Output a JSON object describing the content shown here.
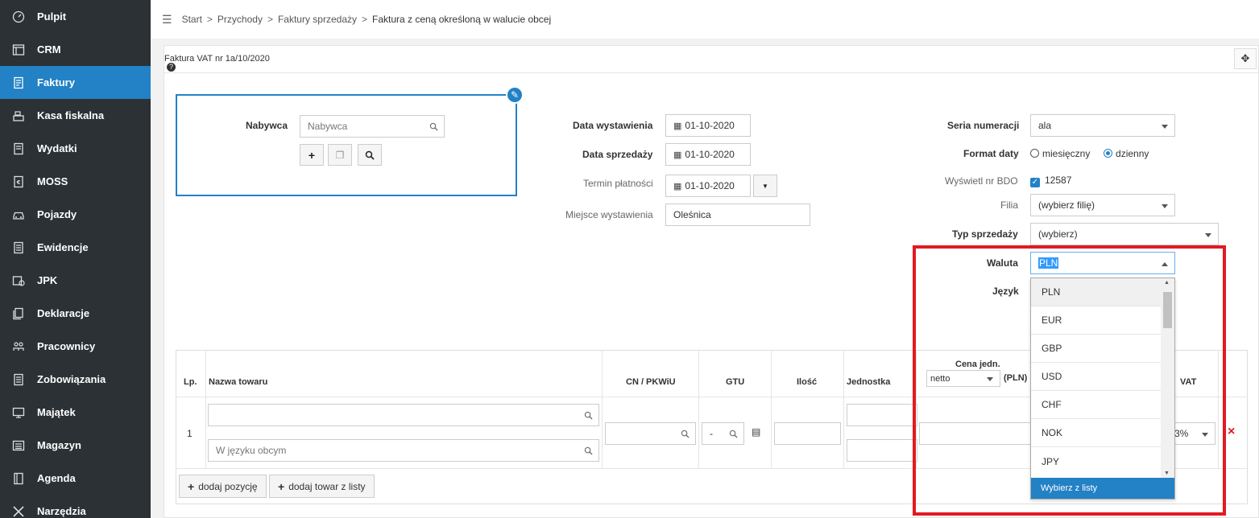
{
  "sidebar": {
    "items": [
      {
        "label": "Pulpit",
        "icon": "dashboard-icon"
      },
      {
        "label": "CRM",
        "icon": "crm-icon"
      },
      {
        "label": "Faktury",
        "icon": "invoice-icon",
        "active": true
      },
      {
        "label": "Kasa fiskalna",
        "icon": "cash-register-icon"
      },
      {
        "label": "Wydatki",
        "icon": "expenses-icon"
      },
      {
        "label": "MOSS",
        "icon": "moss-icon"
      },
      {
        "label": "Pojazdy",
        "icon": "car-icon"
      },
      {
        "label": "Ewidencje",
        "icon": "records-icon"
      },
      {
        "label": "JPK",
        "icon": "jpk-icon"
      },
      {
        "label": "Deklaracje",
        "icon": "declarations-icon"
      },
      {
        "label": "Pracownicy",
        "icon": "employees-icon"
      },
      {
        "label": "Zobowiązania",
        "icon": "liabilities-icon"
      },
      {
        "label": "Majątek",
        "icon": "assets-icon"
      },
      {
        "label": "Magazyn",
        "icon": "warehouse-icon"
      },
      {
        "label": "Agenda",
        "icon": "agenda-icon"
      },
      {
        "label": "Narzędzia",
        "icon": "tools-icon"
      }
    ]
  },
  "breadcrumb": {
    "items": [
      "Start",
      "Przychody",
      "Faktury sprzedaży"
    ],
    "current": "Faktura z ceną określoną w walucie obcej",
    "sep": ">"
  },
  "panel": {
    "title": "Faktura VAT nr 1a/10/2020",
    "help": "?"
  },
  "buyer": {
    "label": "Nabywca",
    "placeholder": "Nabywca"
  },
  "dates": {
    "issue_label": "Data wystawienia",
    "issue_value": "01-10-2020",
    "sale_label": "Data sprzedaży",
    "sale_value": "01-10-2020",
    "due_label": "Termin płatności",
    "due_value": "01-10-2020",
    "place_label": "Miejsce wystawienia",
    "place_value": "Oleśnica"
  },
  "settings": {
    "series_label": "Seria numeracji",
    "series_value": "ala",
    "date_format_label": "Format daty",
    "date_format_monthly": "miesięczny",
    "date_format_daily": "dzienny",
    "bdo_label": "Wyświetl nr BDO",
    "bdo_value": "12587",
    "branch_label": "Filia",
    "branch_value": "(wybierz filię)",
    "sale_type_label": "Typ sprzedaży",
    "sale_type_value": "(wybierz)",
    "currency_label": "Waluta",
    "currency_value": "PLN",
    "language_label": "Język"
  },
  "currency_dropdown": {
    "options": [
      "PLN",
      "EUR",
      "GBP",
      "USD",
      "CHF",
      "NOK",
      "JPY"
    ],
    "footer": "Wybierz z listy"
  },
  "table": {
    "headers": {
      "lp": "Lp.",
      "name": "Nazwa towaru",
      "cn": "CN / PKWiU",
      "gtu": "GTU",
      "qty": "Ilość",
      "unit": "Jednostka",
      "price_title": "Cena jedn.",
      "price_type": "netto",
      "price_currency": "(PLN)",
      "vat": "VAT"
    },
    "row": {
      "lp": "1",
      "foreign_placeholder": "W języku obcym",
      "gtu_value": "-",
      "vat_value": "3%"
    },
    "add_position": "dodaj pozycję",
    "add_from_list": "dodaj towar z listy",
    "remove": "×"
  },
  "colors": {
    "accent": "#2381c5",
    "sidebar": "#2b3135",
    "highlight": "#e11a22"
  }
}
